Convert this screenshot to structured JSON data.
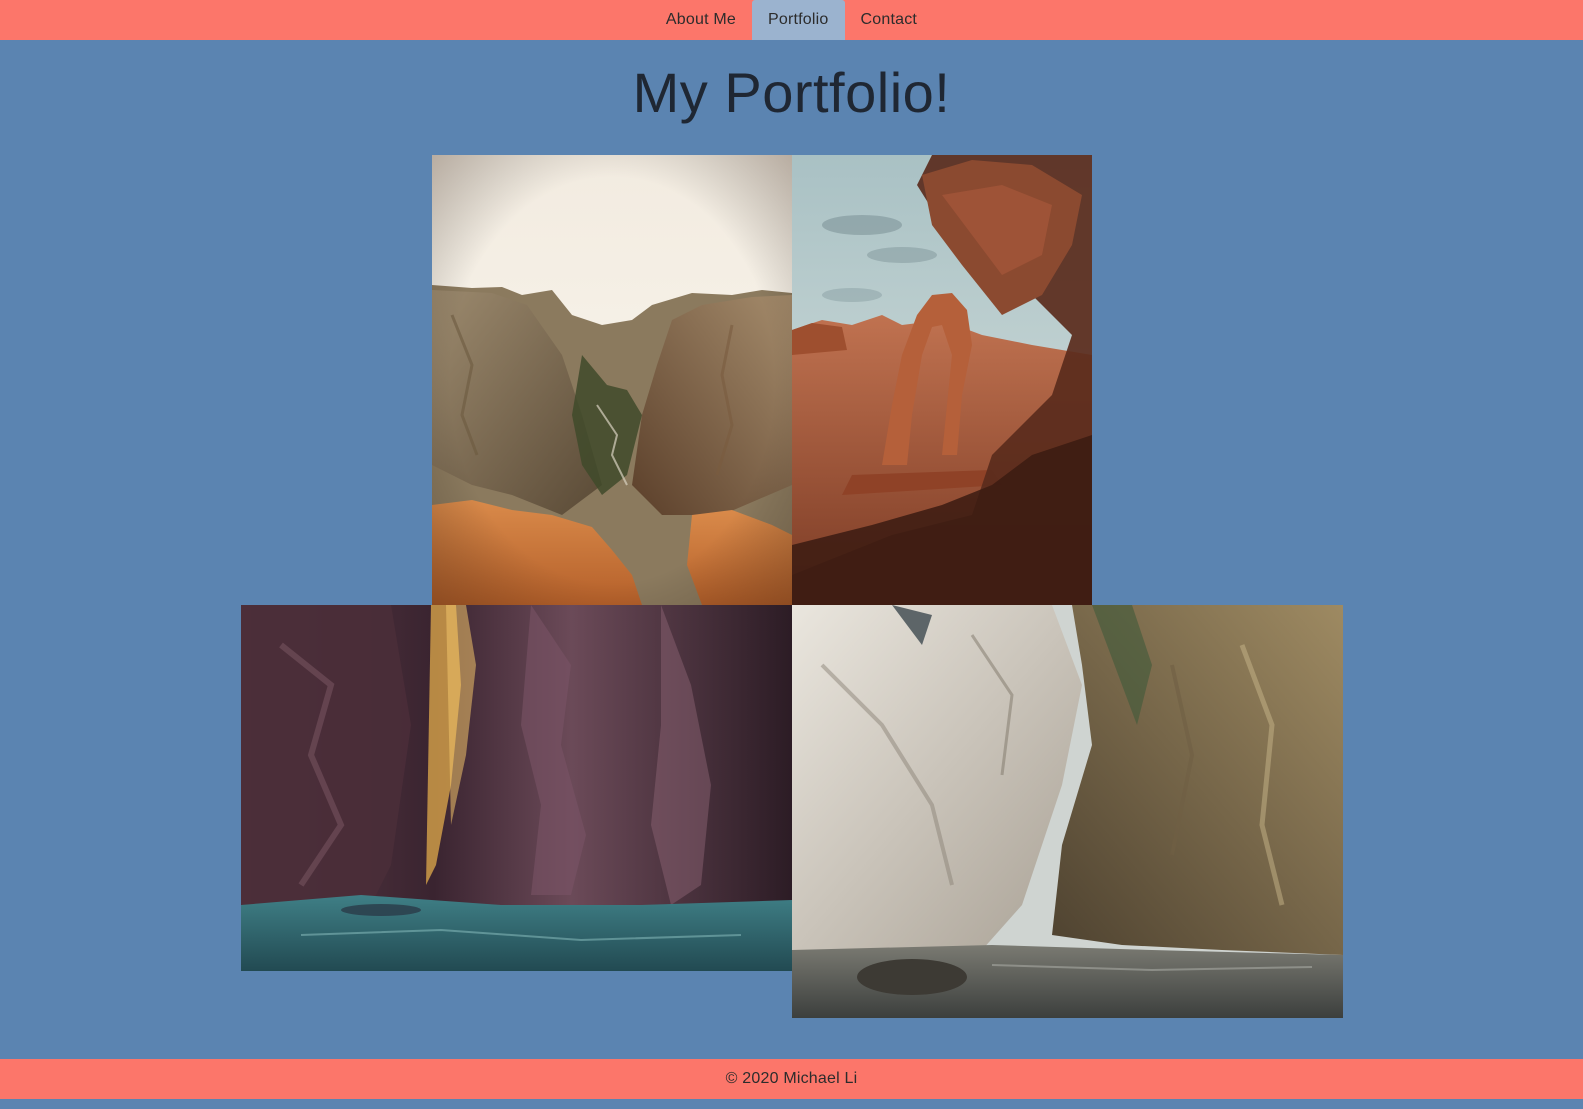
{
  "nav": {
    "items": [
      {
        "label": "About Me",
        "active": false
      },
      {
        "label": "Portfolio",
        "active": true
      },
      {
        "label": "Contact",
        "active": false
      }
    ]
  },
  "page": {
    "title": "My Portfolio!"
  },
  "gallery": {
    "photos": [
      {
        "subject": "canyon overlook with red rock foreground"
      },
      {
        "subject": "red sandstone arch framed by rock"
      },
      {
        "subject": "dark slot canyon with teal river"
      },
      {
        "subject": "pale slot canyon with shallow river"
      }
    ]
  },
  "footer": {
    "text": "© 2020 Michael Li"
  },
  "colors": {
    "background": "#5b84b1",
    "accent": "#fc766a",
    "active_tab": "#9bb3cf"
  }
}
